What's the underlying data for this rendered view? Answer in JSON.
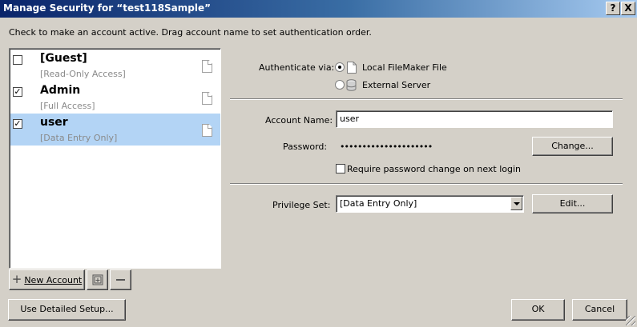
{
  "window": {
    "title": "Manage Security for “test118Sample”",
    "help_label": "?",
    "close_label": "X"
  },
  "instructions": "Check to make an account active.  Drag account name to set authentication order.",
  "accounts": [
    {
      "name": "[Guest]",
      "privilege": "[Read-Only Access]",
      "checked": false,
      "selected": false,
      "check_glyph": ""
    },
    {
      "name": "Admin",
      "privilege": "[Full Access]",
      "checked": true,
      "selected": false,
      "check_glyph": "✓"
    },
    {
      "name": "user",
      "privilege": "[Data Entry Only]",
      "checked": true,
      "selected": true,
      "check_glyph": "✓"
    }
  ],
  "list_buttons": {
    "new_account": "New Account",
    "new_account_icon": "plus-icon",
    "duplicate_icon": "duplicate-icon",
    "delete_icon": "minus-icon"
  },
  "authenticate": {
    "label": "Authenticate via:",
    "options": [
      {
        "label": "Local FileMaker File",
        "selected": true,
        "icon": "document-icon"
      },
      {
        "label": "External Server",
        "selected": false,
        "icon": "database-icon"
      }
    ]
  },
  "account_name": {
    "label": "Account Name:",
    "value": "user"
  },
  "password": {
    "label": "Password:",
    "value": "•••••••••••••••••••••"
  },
  "change_button": "Change...",
  "require_change": {
    "label": "Require password change on next login",
    "checked": false
  },
  "privilege_set": {
    "label": "Privilege Set:",
    "value": "[Data Entry Only]"
  },
  "edit_button": "Edit...",
  "footer": {
    "detailed_setup": "Use Detailed Setup...",
    "ok": "OK",
    "cancel": "Cancel"
  }
}
